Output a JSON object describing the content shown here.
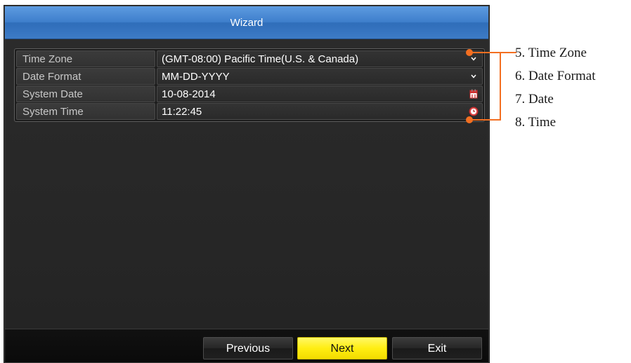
{
  "window": {
    "title": "Wizard"
  },
  "form": {
    "rows": [
      {
        "label": "Time Zone",
        "value": "(GMT-08:00) Pacific Time(U.S. & Canada)",
        "control": "chevron-down-icon"
      },
      {
        "label": "Date Format",
        "value": "MM-DD-YYYY",
        "control": "chevron-down-icon"
      },
      {
        "label": "System Date",
        "value": "10-08-2014",
        "control": "calendar-icon"
      },
      {
        "label": "System Time",
        "value": "11:22:45",
        "control": "clock-icon"
      }
    ]
  },
  "buttons": {
    "previous": "Previous",
    "next": "Next",
    "exit": "Exit"
  },
  "annotations": [
    "5. Time Zone",
    "6. Date Format",
    "7. Date",
    "8. Time"
  ],
  "colors": {
    "title_bar": "#3f7fcc",
    "next_button": "#ffee12",
    "callout": "#f36f21"
  }
}
